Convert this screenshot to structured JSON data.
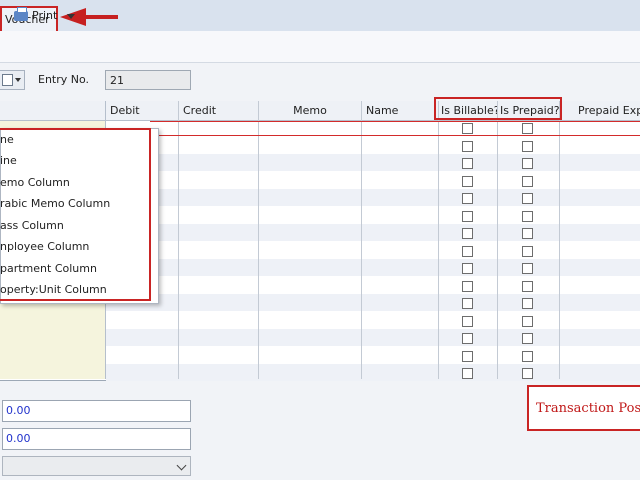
{
  "tab": {
    "label": "Voucher"
  },
  "toolbar": {
    "print_label": "Print"
  },
  "entry": {
    "label": "Entry No.",
    "value": "21"
  },
  "grid": {
    "headers": [
      "Debit",
      "Credit",
      "Memo",
      "Name",
      "Is Billable?",
      "Is Prepaid?",
      "Prepaid Expe"
    ]
  },
  "column_menu": {
    "items": [
      "ne",
      "ine",
      "emo Column",
      "rabic Memo Column",
      "ass Column",
      "nployee Column",
      "partment Column",
      "operty:Unit Column"
    ]
  },
  "totals": {
    "debit": "0.00",
    "credit": "0.00"
  },
  "callout": {
    "text": "Transaction Postin"
  },
  "colors": {
    "highlight": "#c92424",
    "account_column": "#f5f4dd",
    "amount_text": "#2233cc"
  }
}
